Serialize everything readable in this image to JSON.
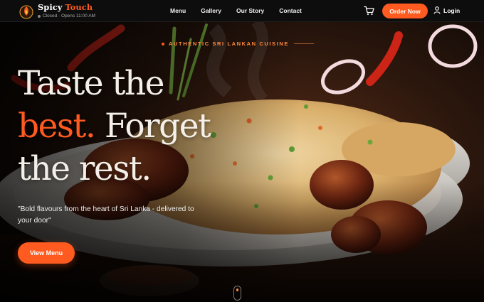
{
  "brand": {
    "name_part1": "Spicy",
    "name_part2": "Touch",
    "status": "Closed · Opens 11:00 AM",
    "accent_color": "#ff5a1f"
  },
  "nav": {
    "items": [
      {
        "label": "Menu"
      },
      {
        "label": "Gallery"
      },
      {
        "label": "Our Story"
      },
      {
        "label": "Contact"
      }
    ]
  },
  "header_actions": {
    "cart_icon": "shopping-cart-icon",
    "order_label": "Order Now",
    "login_icon": "user-icon",
    "login_label": "Login"
  },
  "hero": {
    "eyebrow": "AUTHENTIC SRI LANKAN CUISINE",
    "headline_line1": "Taste the",
    "headline_accent": "best.",
    "headline_line2_rest": "Forget",
    "headline_line3": "the rest.",
    "tagline": "\"Bold flavours from the heart of Sri Lanka - delivered to your door\"",
    "cta_label": "View Menu",
    "background": "fried rice with devilled chicken, chillies and onion rings",
    "scroll_icon": "scroll-mouse-icon"
  }
}
